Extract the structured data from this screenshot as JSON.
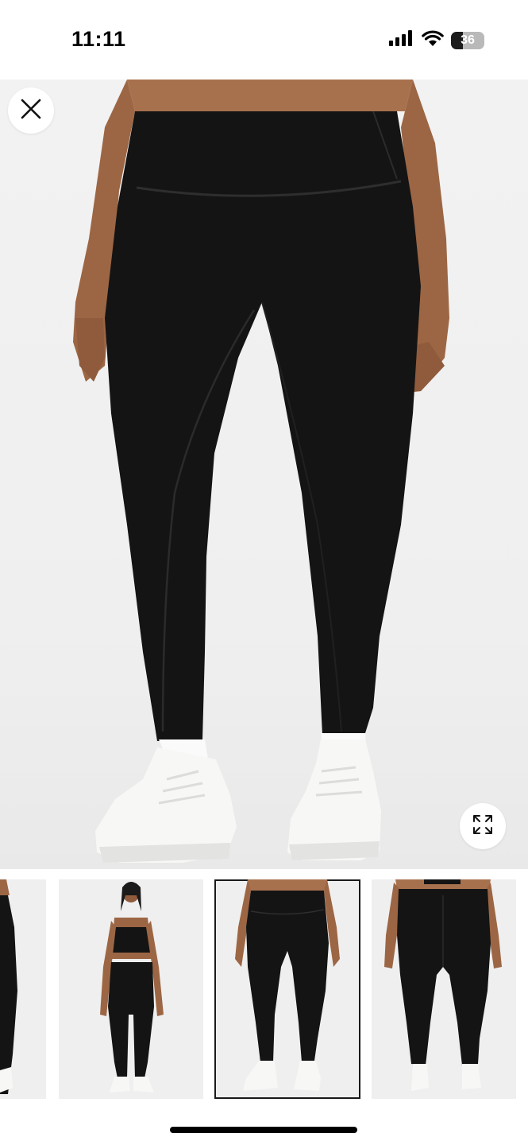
{
  "status_bar": {
    "time": "11:11",
    "battery_level": "36",
    "battery_fraction": 0.36,
    "icons": [
      "cellular-signal-icon",
      "wifi-icon",
      "battery-icon"
    ]
  },
  "viewer": {
    "close_icon": "close-icon",
    "expand_icon": "expand-icon",
    "background_color": "#efefef",
    "garment_color": "#141414",
    "sneaker_color": "#f7f7f5",
    "thumbnails": [
      {
        "view": "partial-left",
        "selected": false
      },
      {
        "view": "full-body-front",
        "selected": false
      },
      {
        "view": "lower-front",
        "selected": true
      },
      {
        "view": "lower-back",
        "selected": false
      }
    ]
  }
}
